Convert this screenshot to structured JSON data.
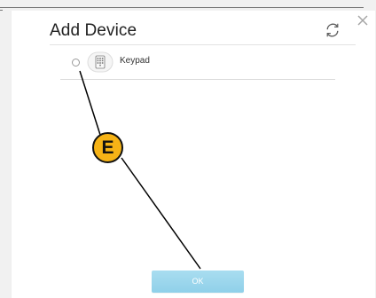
{
  "dialog": {
    "title": "Add Device"
  },
  "devices": [
    {
      "label": "Keypad",
      "icon": "keypad-icon"
    }
  ],
  "ok_button": {
    "label": "OK"
  },
  "callout": {
    "label": "E"
  },
  "colors": {
    "ok_button": "#96d4eb",
    "badge": "#f6b316",
    "dialog_background": "#ffffff"
  }
}
